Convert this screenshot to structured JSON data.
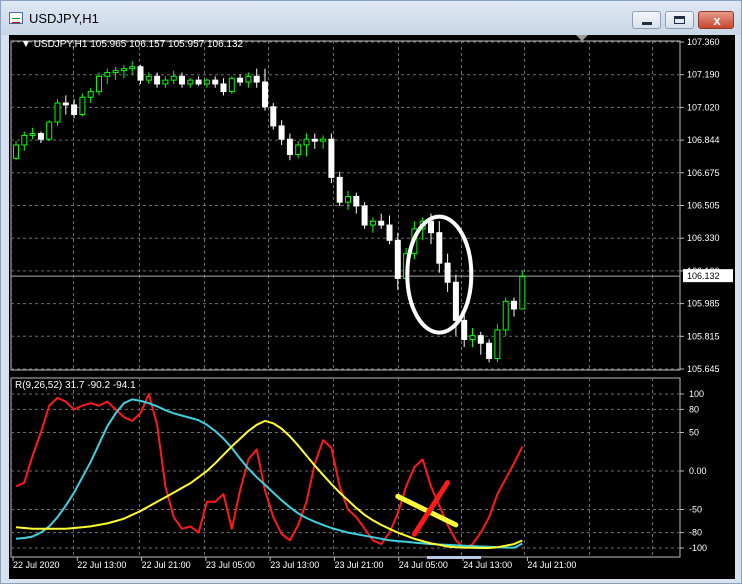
{
  "window": {
    "title": "USDJPY,H1",
    "controls": {
      "minimize": "minimize-icon",
      "maximize": "maximize-icon",
      "close": "close-icon"
    },
    "close_glyph": "x"
  },
  "chart_header": {
    "symbol_text": "USDJPY,H1  105.965 106.157 105.957 106.132",
    "collapse_glyph": "▼"
  },
  "indicator_header": {
    "text": "R(9,26,52) 31.7 -90.2 -94.1"
  },
  "colors": {
    "background": "#000000",
    "grid": "#6e6e6e",
    "bull": "#00ff00",
    "bear": "#ffffff",
    "line_red": "#ff1a1a",
    "line_cyan": "#3fd0e0",
    "line_yellow": "#ffff33",
    "annotation_white": "#ffffff",
    "price_tag_bg": "#ffffff",
    "price_tag_text": "#000000"
  },
  "chart_data": [
    {
      "type": "candlestick",
      "ylim": [
        105.645,
        107.36
      ],
      "price_ticks": [
        "107.360",
        "107.190",
        "107.020",
        "106.844",
        "106.675",
        "106.505",
        "106.330",
        "106.160",
        "105.985",
        "105.815",
        "105.645"
      ],
      "current_price": "106.132",
      "time_labels": [
        "22 Jul 2020",
        "22 Jul 13:00",
        "22 Jul 21:00",
        "23 Jul 05:00",
        "23 Jul 13:00",
        "23 Jul 21:00",
        "24 Jul 05:00",
        "24 Jul 13:00",
        "24 Jul 21:00"
      ],
      "candles": [
        [
          106.75,
          106.84,
          106.74,
          106.82
        ],
        [
          106.82,
          106.89,
          106.79,
          106.87
        ],
        [
          106.87,
          106.91,
          106.85,
          106.88
        ],
        [
          106.88,
          106.89,
          106.83,
          106.85
        ],
        [
          106.85,
          106.95,
          106.84,
          106.94
        ],
        [
          106.94,
          107.06,
          106.92,
          107.04
        ],
        [
          107.04,
          107.08,
          106.98,
          107.03
        ],
        [
          107.03,
          107.06,
          106.96,
          106.98
        ],
        [
          106.98,
          107.09,
          106.97,
          107.07
        ],
        [
          107.07,
          107.12,
          107.04,
          107.1
        ],
        [
          107.1,
          107.2,
          107.08,
          107.18
        ],
        [
          107.18,
          107.22,
          107.14,
          107.2
        ],
        [
          107.2,
          107.23,
          107.16,
          107.21
        ],
        [
          107.21,
          107.24,
          107.17,
          107.22
        ],
        [
          107.22,
          107.26,
          107.19,
          107.23
        ],
        [
          107.23,
          107.24,
          107.14,
          107.16
        ],
        [
          107.16,
          107.2,
          107.14,
          107.18
        ],
        [
          107.18,
          107.2,
          107.12,
          107.14
        ],
        [
          107.14,
          107.18,
          107.12,
          107.16
        ],
        [
          107.16,
          107.21,
          107.14,
          107.18
        ],
        [
          107.18,
          107.2,
          107.12,
          107.14
        ],
        [
          107.14,
          107.17,
          107.12,
          107.16
        ],
        [
          107.16,
          107.18,
          107.13,
          107.14
        ],
        [
          107.14,
          107.17,
          107.12,
          107.16
        ],
        [
          107.16,
          107.18,
          107.12,
          107.14
        ],
        [
          107.14,
          107.17,
          107.08,
          107.1
        ],
        [
          107.1,
          107.18,
          107.09,
          107.17
        ],
        [
          107.17,
          107.19,
          107.13,
          107.15
        ],
        [
          107.15,
          107.2,
          107.12,
          107.18
        ],
        [
          107.18,
          107.22,
          107.12,
          107.15
        ],
        [
          107.15,
          107.22,
          107.0,
          107.02
        ],
        [
          107.02,
          107.04,
          106.9,
          106.92
        ],
        [
          106.92,
          106.95,
          106.82,
          106.85
        ],
        [
          106.85,
          106.88,
          106.74,
          106.77
        ],
        [
          106.77,
          106.84,
          106.75,
          106.82
        ],
        [
          106.82,
          106.88,
          106.76,
          106.85
        ],
        [
          106.85,
          106.88,
          106.8,
          106.84
        ],
        [
          106.84,
          106.87,
          106.8,
          106.85
        ],
        [
          106.85,
          106.88,
          106.62,
          106.65
        ],
        [
          106.65,
          106.68,
          106.5,
          106.52
        ],
        [
          106.52,
          106.58,
          106.48,
          106.55
        ],
        [
          106.55,
          106.57,
          106.46,
          106.5
        ],
        [
          106.5,
          106.52,
          106.38,
          106.4
        ],
        [
          106.4,
          106.44,
          106.36,
          106.42
        ],
        [
          106.42,
          106.46,
          106.38,
          106.4
        ],
        [
          106.4,
          106.45,
          106.3,
          106.32
        ],
        [
          106.32,
          106.36,
          106.06,
          106.12
        ],
        [
          106.12,
          106.28,
          106.1,
          106.25
        ],
        [
          106.25,
          106.42,
          106.22,
          106.38
        ],
        [
          106.38,
          106.44,
          106.32,
          106.42
        ],
        [
          106.42,
          106.46,
          106.3,
          106.36
        ],
        [
          106.36,
          106.42,
          106.15,
          106.2
        ],
        [
          106.2,
          106.25,
          106.05,
          106.1
        ],
        [
          106.1,
          106.14,
          105.82,
          105.9
        ],
        [
          105.9,
          105.95,
          105.76,
          105.8
        ],
        [
          105.8,
          105.86,
          105.76,
          105.82
        ],
        [
          105.82,
          105.84,
          105.72,
          105.78
        ],
        [
          105.78,
          105.8,
          105.68,
          105.7
        ],
        [
          105.7,
          105.88,
          105.68,
          105.85
        ],
        [
          105.85,
          106.02,
          105.82,
          106.0
        ],
        [
          106.0,
          106.02,
          105.92,
          105.96
        ],
        [
          105.96,
          106.16,
          105.96,
          106.13
        ]
      ]
    },
    {
      "type": "line",
      "ylim": [
        -110,
        110
      ],
      "level_ticks": [
        100,
        80,
        50,
        0,
        -50,
        -80,
        -100
      ],
      "series": [
        {
          "color": "#ff1a1a",
          "values": [
            -20,
            -15,
            20,
            50,
            85,
            95,
            90,
            80,
            85,
            88,
            85,
            90,
            80,
            70,
            65,
            75,
            100,
            60,
            -20,
            -60,
            -75,
            -72,
            -80,
            -40,
            -40,
            -30,
            -75,
            -25,
            15,
            28,
            -25,
            -60,
            -82,
            -90,
            -70,
            -40,
            10,
            40,
            30,
            -20,
            -50,
            -60,
            -75,
            -90,
            -95,
            -80,
            -55,
            -20,
            5,
            15,
            -20,
            -45,
            -70,
            -90,
            -100,
            -95,
            -80,
            -60,
            -30,
            -10,
            10,
            31.7
          ]
        },
        {
          "color": "#3fd0e0",
          "values": [
            -88,
            -87,
            -85,
            -80,
            -72,
            -60,
            -45,
            -28,
            -8,
            12,
            35,
            58,
            75,
            88,
            93,
            91,
            88,
            84,
            79,
            75,
            72,
            69,
            66,
            60,
            52,
            42,
            30,
            16,
            3,
            -8,
            -18,
            -28,
            -38,
            -47,
            -55,
            -61,
            -66,
            -70,
            -74,
            -77,
            -80,
            -82,
            -84,
            -86,
            -88,
            -90,
            -91,
            -92,
            -93,
            -94,
            -95,
            -95.5,
            -96,
            -96.5,
            -97,
            -97.5,
            -98,
            -98.5,
            -99,
            -99.5,
            -99.8,
            -94.1
          ]
        },
        {
          "color": "#ffff33",
          "values": [
            -73,
            -74,
            -75,
            -75,
            -75,
            -75,
            -75,
            -74,
            -73,
            -72,
            -70,
            -68,
            -65,
            -62,
            -57,
            -52,
            -46,
            -40,
            -34,
            -28,
            -22,
            -16,
            -8,
            0,
            10,
            21,
            32,
            42,
            52,
            60,
            65,
            62,
            55,
            45,
            33,
            20,
            7,
            -5,
            -17,
            -28,
            -38,
            -48,
            -57,
            -64,
            -70,
            -75,
            -80,
            -84,
            -88,
            -91,
            -94,
            -96,
            -98,
            -99,
            -99.5,
            -99.8,
            -100,
            -100,
            -99,
            -97,
            -95,
            -90.2
          ]
        }
      ]
    }
  ],
  "annotations": {
    "circle": {
      "x_index": 51,
      "price": 106.14
    },
    "yellow_stroke": {
      "from": {
        "x_index": 46,
        "value": -33
      },
      "to": {
        "x_index": 53,
        "value": -70
      }
    },
    "red_stroke": {
      "from": {
        "x_index": 48,
        "value": -82
      },
      "to": {
        "x_index": 52,
        "value": -15
      }
    }
  }
}
